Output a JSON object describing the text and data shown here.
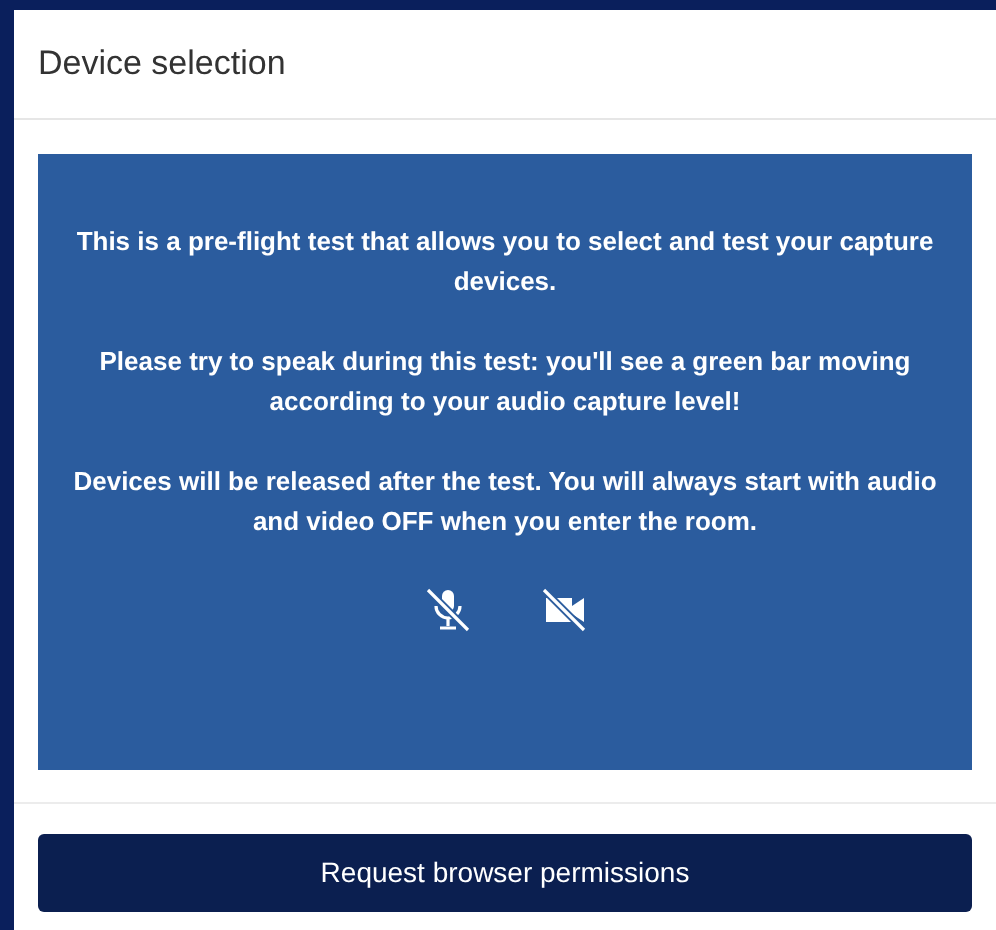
{
  "dialog": {
    "title": "Device selection"
  },
  "info_paragraphs": [
    "This is a pre-flight test that allows you to select and test your capture devices.",
    "Please try to speak during this test: you'll see a green bar moving according to your audio capture level!",
    "Devices will be released after the test. You will always start with audio and video OFF when you enter the room."
  ],
  "devices": [
    {
      "kind": "microphone",
      "muted": true
    },
    {
      "kind": "camera",
      "muted": true
    }
  ],
  "button": "Request browser permissions"
}
